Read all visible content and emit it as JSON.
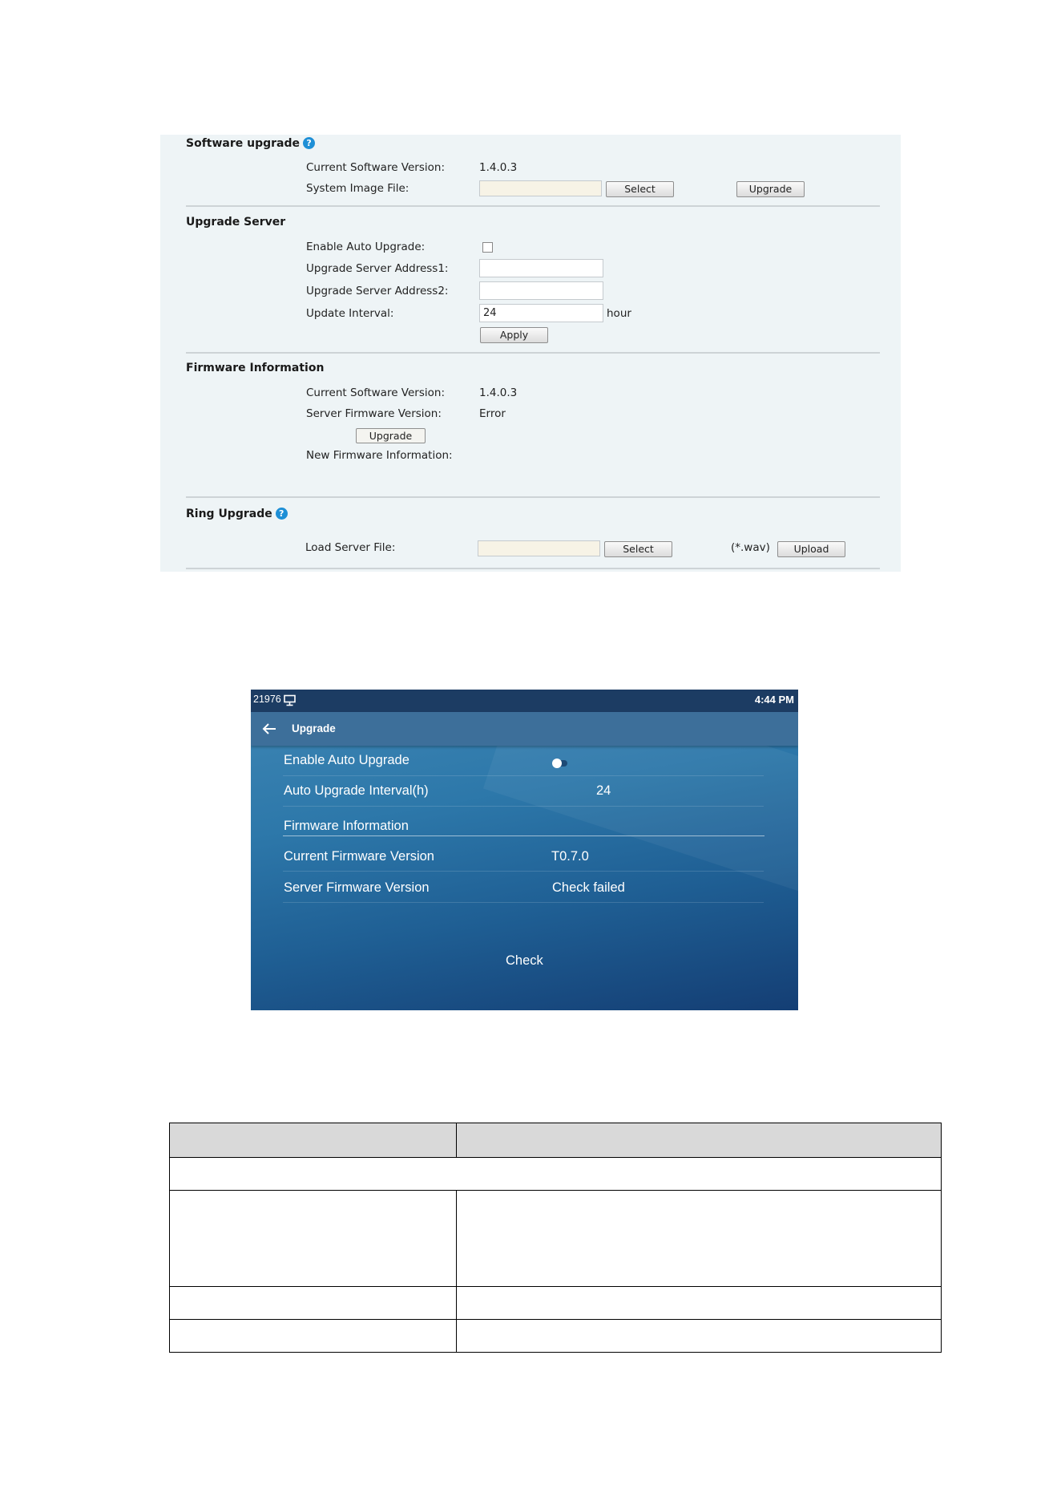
{
  "web_panel": {
    "software_upgrade": {
      "title": "Software upgrade",
      "help_icon": "?",
      "current_version_label": "Current Software Version:",
      "current_version_value": "1.4.0.3",
      "image_file_label": "System Image File:",
      "image_file_value": "",
      "select_label": "Select",
      "upgrade_label": "Upgrade"
    },
    "upgrade_server": {
      "title": "Upgrade Server",
      "auto_upgrade_label": "Enable Auto Upgrade:",
      "auto_upgrade_checked": false,
      "address1_label": "Upgrade Server Address1:",
      "address1_value": "",
      "address2_label": "Upgrade Server Address2:",
      "address2_value": "",
      "interval_label": "Update Interval:",
      "interval_value": "24",
      "interval_unit": "hour",
      "apply_label": "Apply"
    },
    "firmware_information": {
      "title": "Firmware Information",
      "current_version_label": "Current Software Version:",
      "current_version_value": "1.4.0.3",
      "server_version_label": "Server Firmware Version:",
      "server_version_value": "Error",
      "upgrade_label": "Upgrade",
      "new_info_label": "New Firmware Information:"
    },
    "ring_upgrade": {
      "title": "Ring Upgrade",
      "help_icon": "?",
      "load_file_label": "Load Server File:",
      "load_file_value": "",
      "select_label": "Select",
      "ext_hint": "(*.wav)",
      "upload_label": "Upload"
    }
  },
  "phone_panel": {
    "status_bar": {
      "extension": "21976",
      "time": "4:44 PM"
    },
    "app_bar": {
      "title": "Upgrade"
    },
    "rows": {
      "auto_upgrade_label": "Enable Auto Upgrade",
      "interval_label": "Auto Upgrade Interval(h)",
      "interval_value": "24",
      "firmware_header": "Firmware Information",
      "current_fw_label": "Current Firmware Version",
      "current_fw_value": "T0.7.0",
      "server_fw_label": "Server Firmware Version",
      "server_fw_value": "Check failed"
    },
    "check_label": "Check"
  },
  "colors": {
    "web_bg": "#eef4f6",
    "help_icon": "#1e8fd6",
    "phone_status_bar": "#1c3c63",
    "phone_app_bar": "#3d6f9a",
    "table_header": "#d9d9d9"
  }
}
